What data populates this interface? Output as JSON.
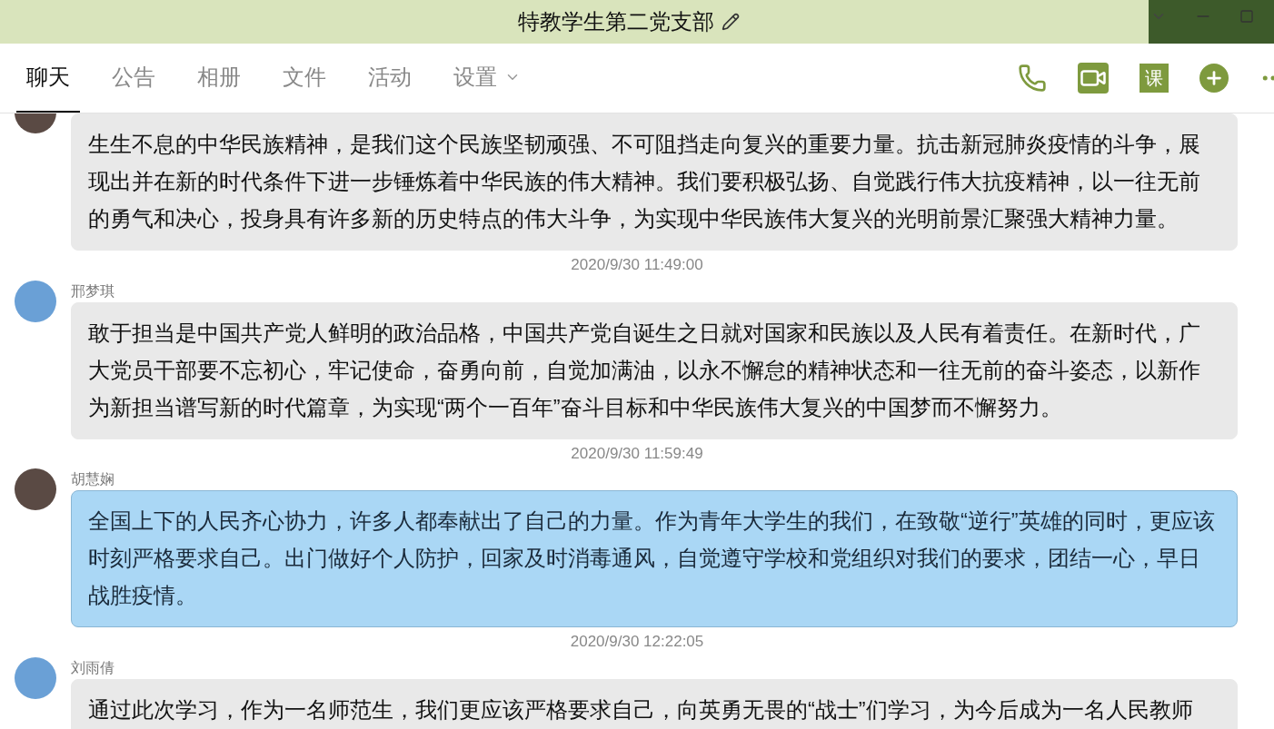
{
  "window": {
    "title": "特教学生第二党支部"
  },
  "tabs": [
    {
      "label": "聊天",
      "selected": true,
      "has_menu": false
    },
    {
      "label": "公告",
      "selected": false,
      "has_menu": false
    },
    {
      "label": "相册",
      "selected": false,
      "has_menu": false
    },
    {
      "label": "文件",
      "selected": false,
      "has_menu": false
    },
    {
      "label": "活动",
      "selected": false,
      "has_menu": false
    },
    {
      "label": "设置",
      "selected": false,
      "has_menu": true
    }
  ],
  "toolbar": {
    "class_button": "课"
  },
  "messages": [
    {
      "kind": "message",
      "highlighted": false,
      "text": "生生不息的中华民族精神，是我们这个民族坚韧顽强、不可阻挡走向复兴的重要力量。抗击新冠肺炎疫情的斗争，展现出并在新的时代条件下进一步锤炼着中华民族的伟大精神。我们要积极弘扬、自觉践行伟大抗疫精神，以一往无前的勇气和决心，投身具有许多新的历史特点的伟大斗争，为实现中华民族伟大复兴的光明前景汇聚强大精神力量。"
    },
    {
      "kind": "time",
      "text": "2020/9/30 11:49:00"
    },
    {
      "kind": "message",
      "sender": "邢梦琪",
      "highlighted": false,
      "text": "敢于担当是中国共产党人鲜明的政治品格，中国共产党自诞生之日就对国家和民族以及人民有着责任。在新时代，广大党员干部要不忘初心，牢记使命，奋勇向前，自觉加满油，以永不懈怠的精神状态和一往无前的奋斗姿态，以新作为新担当谱写新的时代篇章，为实现“两个一百年”奋斗目标和中华民族伟大复兴的中国梦而不懈努力。"
    },
    {
      "kind": "time",
      "text": "2020/9/30 11:59:49"
    },
    {
      "kind": "message",
      "sender": "胡慧娴",
      "highlighted": true,
      "text": "全国上下的人民齐心协力，许多人都奉献出了自己的力量。作为青年大学生的我们，在致敬“逆行”英雄的同时，更应该时刻严格要求自己。出门做好个人防护，回家及时消毒通风，自觉遵守学校和党组织对我们的要求，团结一心，早日战胜疫情。"
    },
    {
      "kind": "time",
      "text": "2020/9/30 12:22:05"
    },
    {
      "kind": "message",
      "sender": "刘雨倩",
      "highlighted": false,
      "text": "通过此次学习，作为一名师范生，我们更应该严格要求自己，向英勇无畏的“战士”们学习，为今后成为一名人民教师"
    }
  ]
}
